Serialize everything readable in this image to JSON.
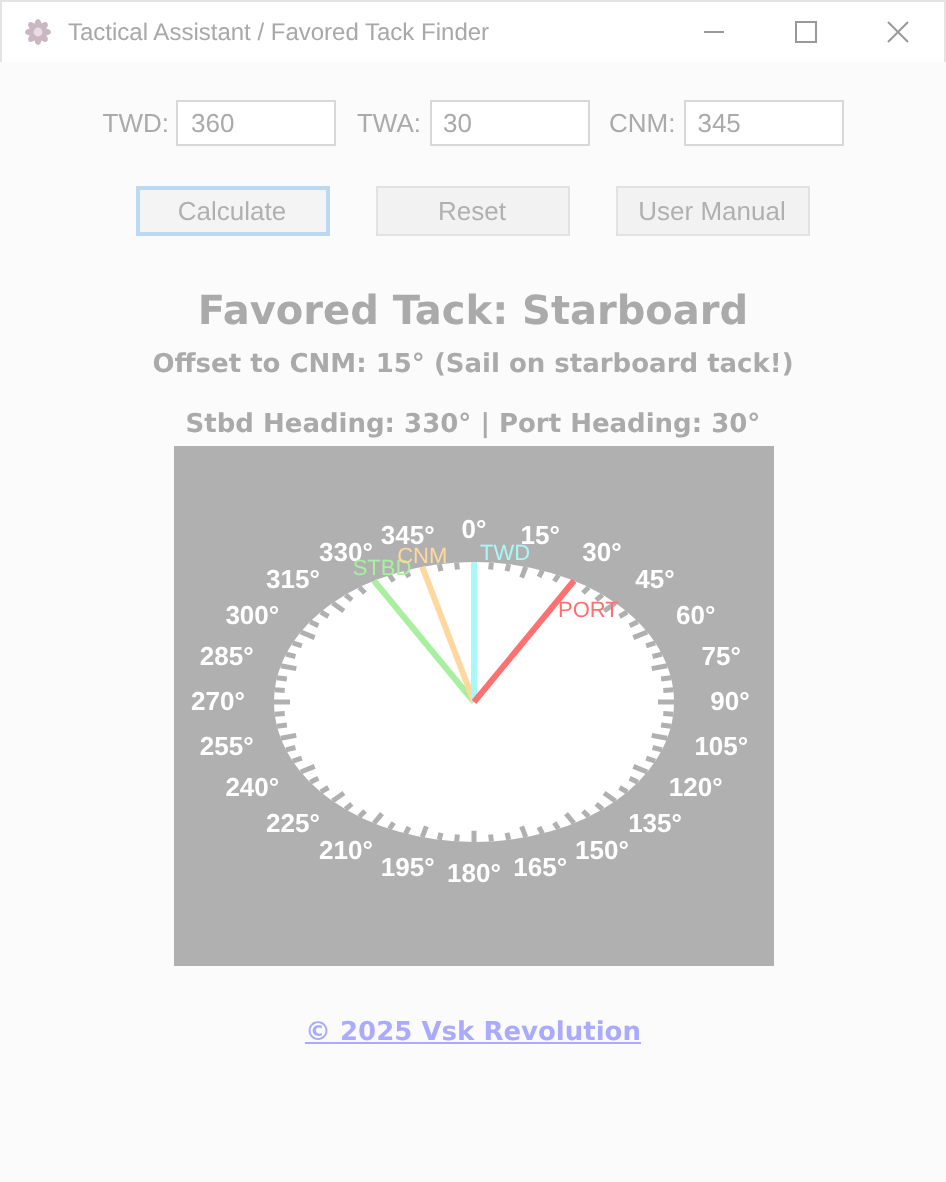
{
  "window": {
    "title": "Tactical Assistant / Favored Tack Finder"
  },
  "fields": [
    {
      "label": "TWD:",
      "value": "360"
    },
    {
      "label": "TWA:",
      "value": "30"
    },
    {
      "label": "CNM:",
      "value": "345"
    }
  ],
  "buttons": [
    {
      "label": "Calculate",
      "focused": true
    },
    {
      "label": "Reset",
      "focused": false
    },
    {
      "label": "User Manual",
      "focused": false
    }
  ],
  "result": {
    "title": "Favored Tack: Starboard",
    "offset": "Offset to CNM: 15° (Sail on starboard tack!)",
    "headings": "Stbd Heading: 330° | Port Heading: 30°"
  },
  "compass": {
    "lines": [
      {
        "label": "STBD",
        "heading": "330°",
        "color": "#a8f0a0"
      },
      {
        "label": "CNM",
        "heading": "345°",
        "color": "#ffd8a0"
      },
      {
        "label": "TWD",
        "heading": "0°",
        "color": "#a8f8f8"
      },
      {
        "label": "PORT",
        "heading": "30°",
        "color": "#ff7070"
      }
    ],
    "degree_marks": [
      {
        "text": "15°"
      },
      {
        "text": "315°"
      },
      {
        "text": "45°"
      },
      {
        "text": "300°"
      },
      {
        "text": "60°"
      },
      {
        "text": "285°"
      },
      {
        "text": "75°"
      },
      {
        "text": "270°"
      },
      {
        "text": "90°"
      },
      {
        "text": "255°"
      },
      {
        "text": "105°"
      },
      {
        "text": "240°"
      },
      {
        "text": "120°"
      },
      {
        "text": "225°"
      },
      {
        "text": "135°"
      },
      {
        "text": "210°"
      },
      {
        "text": "150°"
      },
      {
        "text": "195°"
      },
      {
        "text": "180°"
      },
      {
        "text": "165°"
      }
    ]
  },
  "footer": {
    "link": "© 2025 Vsk Revolution"
  }
}
